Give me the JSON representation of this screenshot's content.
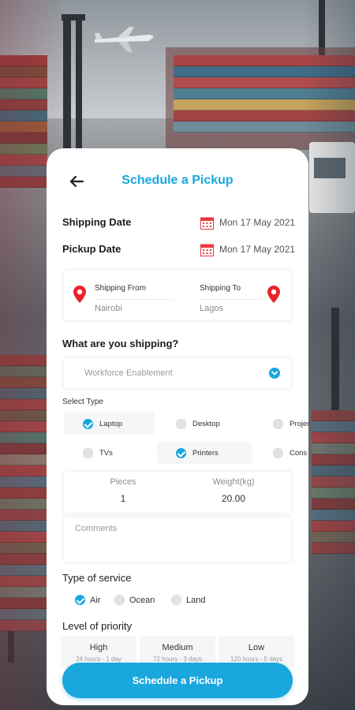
{
  "header": {
    "title": "Schedule a Pickup"
  },
  "dates": {
    "shipping_label": "Shipping Date",
    "shipping_value": "Mon 17 May 2021",
    "pickup_label": "Pickup Date",
    "pickup_value": "Mon 17 May 2021"
  },
  "route": {
    "from_label": "Shipping From",
    "from_value": "Nairobi",
    "to_label": "Shipping To",
    "to_value": "Lagos"
  },
  "shipping": {
    "question": "What are you shipping?",
    "selected": "Workforce Enablement"
  },
  "types": {
    "label": "Select Type",
    "items": [
      {
        "label": "Laptop",
        "checked": true
      },
      {
        "label": "Desktop",
        "checked": false
      },
      {
        "label": "Projec",
        "checked": false
      },
      {
        "label": "TVs",
        "checked": false
      },
      {
        "label": "Printers",
        "checked": true
      },
      {
        "label": "Cons",
        "checked": false
      }
    ]
  },
  "quantity": {
    "pieces_label": "Pieces",
    "pieces_value": "1",
    "weight_label": "Weight(kg)",
    "weight_value": "20.00"
  },
  "comments": {
    "placeholder": "Comments"
  },
  "service": {
    "label": "Type of service",
    "options": [
      {
        "label": "Air",
        "checked": true
      },
      {
        "label": "Ocean",
        "checked": false
      },
      {
        "label": "Land",
        "checked": false
      }
    ]
  },
  "priority": {
    "label": "Level of priority",
    "options": [
      {
        "name": "High",
        "sub": "24 hours - 1 day"
      },
      {
        "name": "Medium",
        "sub": "72 hours - 3 days"
      },
      {
        "name": "Low",
        "sub": "120 hours - 5 days"
      }
    ]
  },
  "cta": {
    "label": "Schedule a Pickup"
  },
  "colors": {
    "accent": "#1aa7dd",
    "pin": "#e8242d",
    "calendar": "#e8393f"
  }
}
